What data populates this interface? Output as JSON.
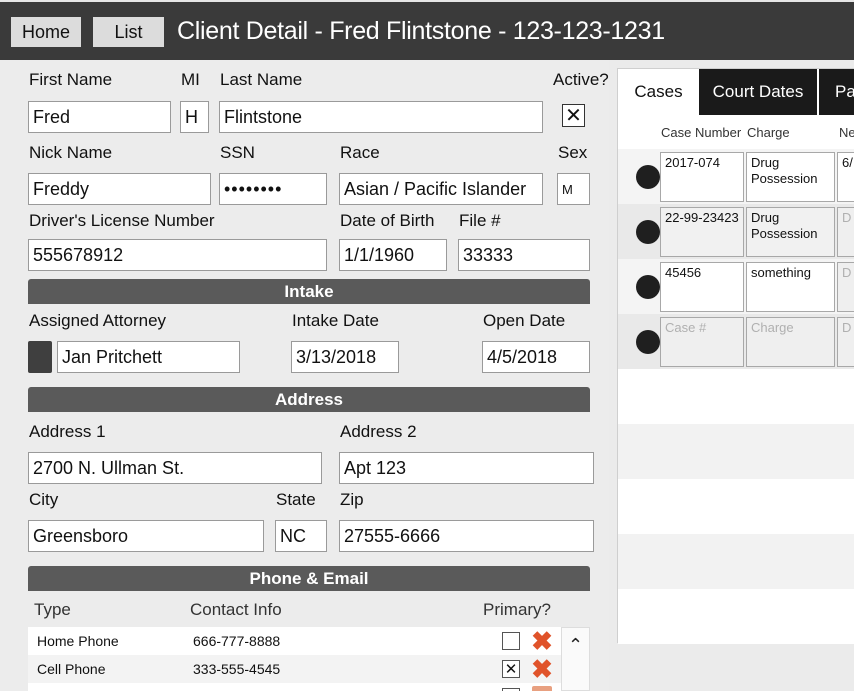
{
  "header": {
    "home_label": "Home",
    "list_label": "List",
    "title": "Client Detail - Fred Flintstone - 123-123-1231"
  },
  "client": {
    "first_name_label": "First Name",
    "mi_label": "MI",
    "last_name_label": "Last Name",
    "active_label": "Active?",
    "first_name": "Fred",
    "mi": "H",
    "last_name": "Flintstone",
    "active_mark": "✕",
    "nick_name_label": "Nick Name",
    "ssn_label": "SSN",
    "race_label": "Race",
    "sex_label": "Sex",
    "nick_name": "Freddy",
    "ssn": "••••••••",
    "race": "Asian / Pacific Islander",
    "sex": "M",
    "dl_label": "Driver's License Number",
    "dob_label": "Date of Birth",
    "file_label": "File #",
    "dl": "555678912",
    "dob": "1/1/1960",
    "file": "33333"
  },
  "intake": {
    "section_title": "Intake",
    "attorney_label": "Assigned Attorney",
    "intake_date_label": "Intake Date",
    "open_date_label": "Open Date",
    "attorney": "Jan Pritchett",
    "intake_date": "3/13/2018",
    "open_date": "4/5/2018"
  },
  "address": {
    "section_title": "Address",
    "address1_label": "Address 1",
    "address2_label": "Address 2",
    "address1": "2700 N. Ullman St.",
    "address2": "Apt 123",
    "city_label": "City",
    "state_label": "State",
    "zip_label": "Zip",
    "city": "Greensboro",
    "state": "NC",
    "zip": "27555-6666"
  },
  "phone": {
    "section_title": "Phone & Email",
    "type_header": "Type",
    "contact_header": "Contact Info",
    "primary_header": "Primary?",
    "rows": [
      {
        "type": "Home Phone",
        "contact": "666-777-8888",
        "primary": ""
      },
      {
        "type": "Cell Phone",
        "contact": "333-555-4545",
        "primary": "✕"
      }
    ],
    "delete_glyph": "✖",
    "scroll_up_glyph": "⌃"
  },
  "right": {
    "tabs": [
      "Cases",
      "Court Dates",
      "Pa"
    ],
    "col_case_number": "Case Number",
    "col_charge": "Charge",
    "col_next": "Ne",
    "cases": [
      {
        "number": "2017-074",
        "charge": "Drug Possession",
        "next": "6/"
      },
      {
        "number": "22-99-23423",
        "charge": "Drug Possession",
        "next": "D"
      },
      {
        "number": "45456",
        "charge": "something",
        "next": "D"
      }
    ],
    "new_case_placeholder": "Case #",
    "new_charge_placeholder": "Charge",
    "new_next_placeholder": "D"
  }
}
